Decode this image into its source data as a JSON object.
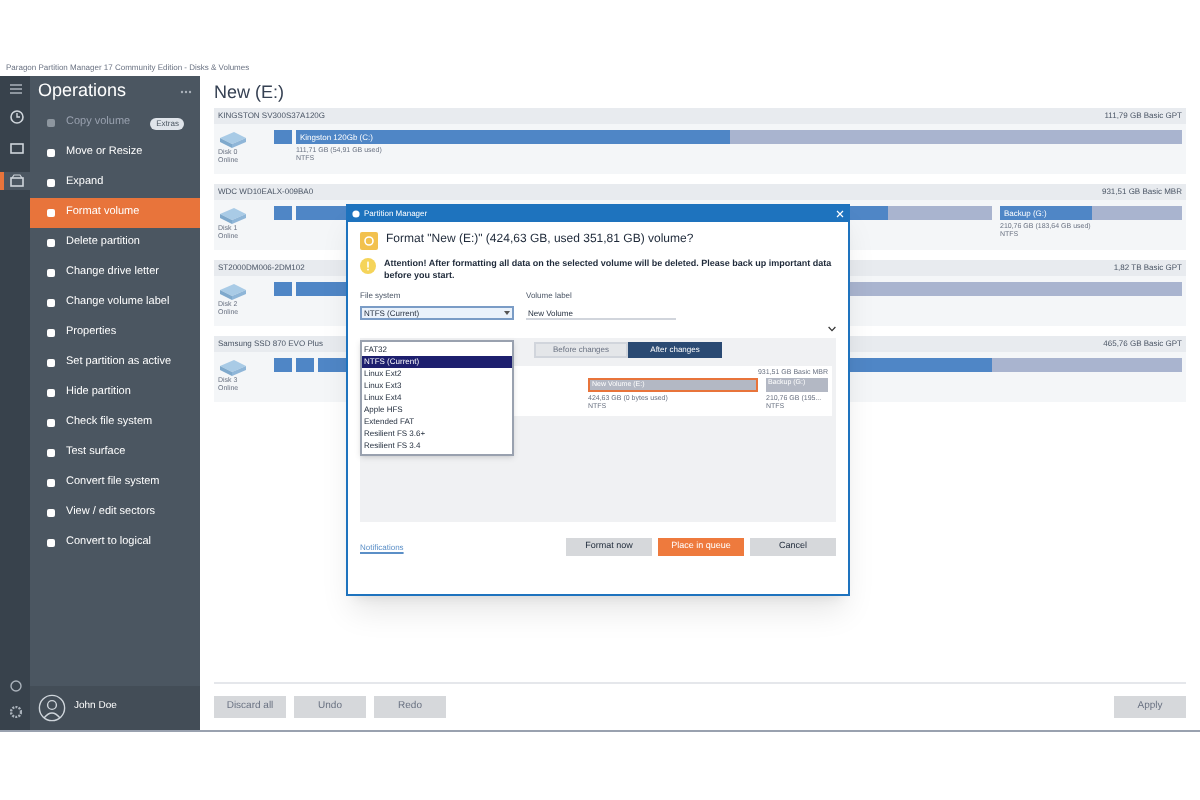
{
  "window": {
    "title": "Paragon Partition Manager 17 Community Edition - Disks & Volumes"
  },
  "rail": [
    {
      "selected": false
    },
    {
      "selected": false
    },
    {
      "selected": true
    }
  ],
  "sidebar": {
    "title": "Operations",
    "items": [
      {
        "label": "Copy volume",
        "disabled": true,
        "selected": false,
        "badge": "Extras"
      },
      {
        "label": "Move or Resize",
        "disabled": false,
        "selected": false
      },
      {
        "label": "Expand",
        "disabled": false,
        "selected": false
      },
      {
        "label": "Format volume",
        "disabled": false,
        "selected": true
      },
      {
        "label": "Delete partition",
        "disabled": false,
        "selected": false
      },
      {
        "label": "Change drive letter",
        "disabled": false,
        "selected": false
      },
      {
        "label": "Change volume label",
        "disabled": false,
        "selected": false
      },
      {
        "label": "Properties",
        "disabled": false,
        "selected": false
      },
      {
        "label": "Set partition as active",
        "disabled": false,
        "selected": false
      },
      {
        "label": "Hide partition",
        "disabled": false,
        "selected": false
      },
      {
        "label": "Check file system",
        "disabled": false,
        "selected": false
      },
      {
        "label": "Test surface",
        "disabled": false,
        "selected": false
      },
      {
        "label": "Convert file system",
        "disabled": false,
        "selected": false
      },
      {
        "label": "View / edit sectors",
        "disabled": false,
        "selected": false
      },
      {
        "label": "Convert to logical",
        "disabled": false,
        "selected": false
      }
    ],
    "user": {
      "name": "John Doe"
    }
  },
  "main": {
    "heading": "New (E:)",
    "disks": [
      {
        "model": "KINGSTON SV300S37A120G",
        "size": "111,79 GB Basic GPT",
        "name": "Disk 0",
        "status": "Online",
        "partitions": [
          {
            "kind": "system"
          },
          {
            "kind": "volume",
            "label": "Kingston 120Gb (C:)",
            "detail": "111,71 GB (54,91 GB used)",
            "fs": "NTFS",
            "level": 0.49
          }
        ]
      },
      {
        "model": "WDC WD10EALX-009BA0",
        "size": "931,51 GB Basic MBR",
        "name": "Disk 1",
        "status": "Online",
        "partitions": [
          {
            "kind": "system"
          },
          {
            "kind": "volume",
            "level": 0.85
          },
          {
            "kind": "volume",
            "label": "Backup (G:)",
            "detail": "210,76 GB (183,64 GB used)",
            "fs": "NTFS",
            "level": 0.5
          }
        ]
      },
      {
        "model": "ST2000DM006-2DM102",
        "size": "1,82 TB Basic GPT",
        "name": "Disk 2",
        "status": "Online",
        "partitions": [
          {
            "kind": "system"
          },
          {
            "kind": "volume",
            "level": 0.3
          }
        ]
      },
      {
        "model": "Samsung SSD 870 EVO Plus",
        "size": "465,76 GB Basic GPT",
        "name": "Disk 3",
        "status": "Online",
        "partitions": [
          {
            "kind": "system"
          },
          {
            "kind": "system"
          },
          {
            "kind": "volume",
            "level": 0.78
          }
        ]
      }
    ],
    "actions": [
      {
        "label": "Discard all"
      },
      {
        "label": "Undo"
      },
      {
        "label": "Redo"
      }
    ],
    "apply": "Apply"
  },
  "dialog": {
    "title": "Partition Manager",
    "question": "Format \"New (E:)\" (424,63 GB, used 351,81 GB) volume?",
    "warning": "Attention! After formatting all data on the selected volume will be deleted. Please back up important data before you start.",
    "file_system_label": "File system",
    "file_system_value": "NTFS (Current)",
    "volume_label_label": "Volume label",
    "volume_label_value": "New Volume",
    "options": [
      {
        "label": "FAT32",
        "selected": false
      },
      {
        "label": "NTFS (Current)",
        "selected": true
      },
      {
        "label": "Linux Ext2",
        "selected": false
      },
      {
        "label": "Linux Ext3",
        "selected": false
      },
      {
        "label": "Linux Ext4",
        "selected": false
      },
      {
        "label": "Apple HFS",
        "selected": false
      },
      {
        "label": "Extended FAT",
        "selected": false
      },
      {
        "label": "Resilient FS 3.6+",
        "selected": false
      },
      {
        "label": "Resilient FS 3.4",
        "selected": false
      }
    ],
    "tabs": [
      {
        "label": "Before changes",
        "selected": false
      },
      {
        "label": "After changes",
        "selected": true
      }
    ],
    "preview": {
      "size": "931,51 GB Basic MBR",
      "partitions": [
        {
          "label": "New Volume (E:)",
          "detail": "424,63 GB (0 bytes used)",
          "fs": "NTFS",
          "selected": true
        },
        {
          "label": "Backup (G:)",
          "detail": "210,76 GB (195...",
          "fs": "NTFS",
          "selected": false
        }
      ]
    },
    "link": "Notifications",
    "buttons": [
      {
        "label": "Format now",
        "kind": "default"
      },
      {
        "label": "Place in queue",
        "kind": "primary"
      },
      {
        "label": "Cancel",
        "kind": "default"
      }
    ]
  }
}
